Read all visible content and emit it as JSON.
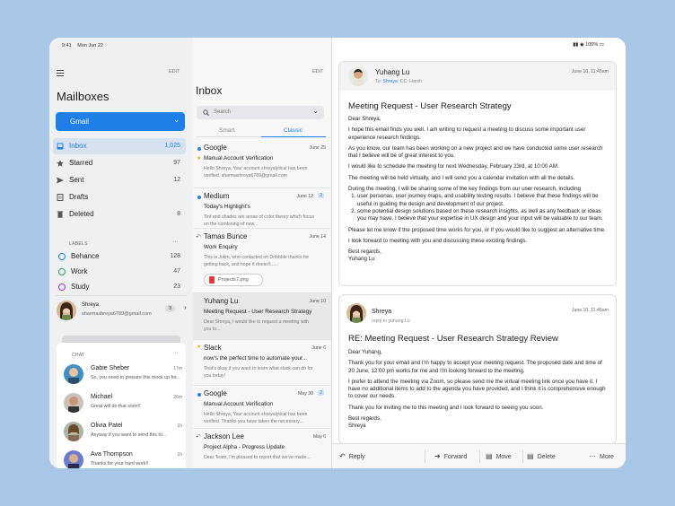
{
  "status": {
    "time": "9:41",
    "date": "Mon Jun 22",
    "battery": "100%"
  },
  "mailboxes": {
    "edit_label": "EDIT",
    "title": "Mailboxes",
    "account_selector": "Gmail",
    "items": [
      {
        "label": "Inbox",
        "count": "1,025",
        "icon": "inbox-icon"
      },
      {
        "label": "Starred",
        "count": "97",
        "icon": "star-icon"
      },
      {
        "label": "Sent",
        "count": "12",
        "icon": "send-icon"
      },
      {
        "label": "Drafts",
        "count": "",
        "icon": "draft-icon"
      },
      {
        "label": "Deleted",
        "count": "8",
        "icon": "trash-icon"
      }
    ],
    "labels_heading": "LABELS",
    "labels": [
      {
        "label": "Behance",
        "count": "128",
        "color": "#1e80e6"
      },
      {
        "label": "Work",
        "count": "47",
        "color": "#34a853"
      },
      {
        "label": "Study",
        "count": "23",
        "color": "#9b3bd1"
      }
    ],
    "account": {
      "name": "Shreya",
      "email": "sharmashreya6789@gmail.com",
      "badge": "3"
    }
  },
  "chat": {
    "heading": "CHAT",
    "items": [
      {
        "name": "Gabie Sheber",
        "message": "So, you need to prepare this mock up for...",
        "time": "17m"
      },
      {
        "name": "Michael",
        "message": "Great will do that soon!!",
        "time": "26m"
      },
      {
        "name": "Olivia Patel",
        "message": "Anyway if you want to send this to...",
        "time": "1h"
      },
      {
        "name": "Ava Thompson",
        "message": "Thanks for your hard work!!",
        "time": "1h"
      }
    ]
  },
  "inbox": {
    "edit_label": "EDIT",
    "title": "Inbox",
    "search_placeholder": "Search",
    "tabs": [
      "Smart",
      "Classic"
    ],
    "emails": [
      {
        "from": "Google",
        "date": "June 25",
        "subject": "Manual Account Verification",
        "preview": "Hello Shreya, Your account shreyalytical has been verified. sharmashreya6789@gmail.com"
      },
      {
        "from": "Medium",
        "date": "June 12",
        "badge": "2",
        "subject": "Today's Highlight's",
        "preview": "Tint and shades are areas of color theory which focus on the combining of new..."
      },
      {
        "from": "Tamas Bunce",
        "date": "June 14",
        "subject": "Work Enquiry",
        "preview": "This is Julim, who  contacted on Dribbble thanks for getting back, and hope it doesn't......",
        "attachment": "Projects7.png"
      },
      {
        "from": "Yuhang Lu",
        "date": "June 10",
        "subject": "Meeting Request - User Research Strategy",
        "preview": "Dear Shreya, I would like to request a meeting with you to..."
      },
      {
        "from": "Slack",
        "date": "June 6",
        "subject": "now's the perfect time to automate your...",
        "preview": "That's okay if you want to learn what slack can do for you today!"
      },
      {
        "from": "Google",
        "date": "May 30",
        "badge": "2",
        "subject": "Manual Account Verification",
        "preview": "Hello Shreya, Your account shreyalytical has been verified. Thanks you have taken the necessary..."
      },
      {
        "from": "Jackson Lee",
        "date": "May 6",
        "subject": "Project Alpha - Progress Update",
        "preview": "Dear Team, I'm pleased to report that we've made..."
      }
    ]
  },
  "reading": {
    "message1": {
      "from": "Yuhang Lu",
      "to_label": "To:",
      "to": "Shreya",
      "cc": "CC: Harsh",
      "date": "June 10, 11:45am",
      "subject": "Meeting Request - User Research Strategy",
      "greeting": "Dear Shreya,",
      "p1": "I hope this email finds you well. I am writing to request a meeting to discuss some important user experience research findings.",
      "p2": "As you know, our team has been working on a new project and we have conducted some user research that I believe will be of great interest to you.",
      "p3": "I would like to schedule the meeting for next Wednesday, February 23rd, at 10:00 AM.",
      "p4": "The meeting will be held virtually, and I will send you a calendar invitation with all the details.",
      "p5": "During the meeting, I will be sharing some of the key findings from our user research, including",
      "li1": "user personas, user journey maps, and usability testing results. I believe that these findings will be useful in guiding the design and development of our project.",
      "li2": "some potential design solutions based on these research insights, as well as any feedback or ideas you may have. I believe that your expertise in UX design and your input will be valuable to our team.",
      "p6": "Please let me know if the proposed time works for you, or if you would like to suggest an alternative time.",
      "p7": "I look forward to meeting with you and discussing these exciting findings.",
      "signoff": "Best regards,",
      "sig": "Yuhang Lu"
    },
    "message2": {
      "from": "Shreya",
      "to": "reply to yuhang Lu",
      "date": "June 10, 11:45am",
      "subject": "RE: Meeting Request - User Research Strategy Review",
      "greeting": "Dear Yuhang,",
      "p1": "Thank you for your email and I'm happy to accept your meeting request. The proposed date and time of 20 June, 12:00 pm works for me and I'm looking forward to the meeting.",
      "p2": "I prefer to attend the meeting via Zoom, so please send me the virtual meeting link once you have it. I have no additional items to add to the agenda you have provided, and I think it is comprehensive enough to cover our needs.",
      "p3": "Thank you for inviting me to this meeting and I look forward to seeing you soon.",
      "signoff": "Best regards,",
      "sig": "Shreya"
    },
    "toolbar": {
      "reply": "Reply",
      "forward": "Forward",
      "move": "Move",
      "delete": "Delete",
      "more": "More"
    }
  },
  "colors": {
    "accent": "#1e80e6",
    "background": "#a9c8e8",
    "unread_dot": "#1e80e6",
    "star": "#f5b400"
  }
}
